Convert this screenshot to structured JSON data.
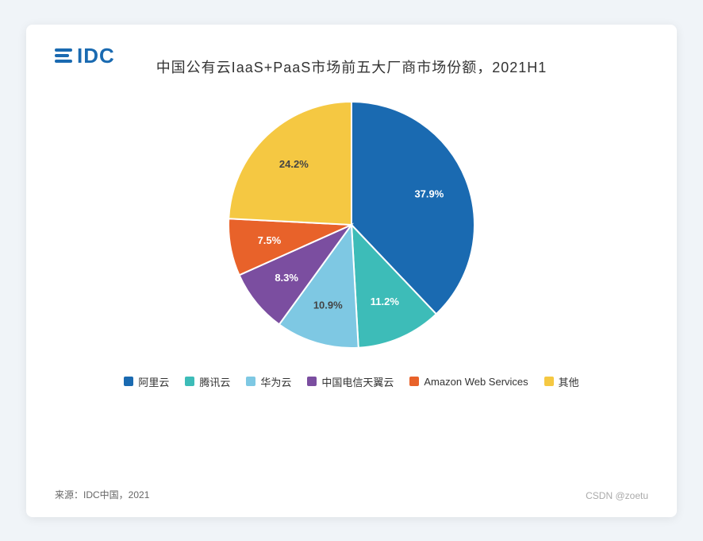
{
  "logo": {
    "text": "IDC"
  },
  "title": "中国公有云IaaS+PaaS市场前五大厂商市场份额，2021H1",
  "chart": {
    "segments": [
      {
        "name": "阿里云",
        "value": 37.9,
        "color": "#1a6ab1",
        "labelColor": "white"
      },
      {
        "name": "腾讯云",
        "value": 11.2,
        "color": "#3dbcb8",
        "labelColor": "white"
      },
      {
        "name": "华为云",
        "value": 10.9,
        "color": "#7ec8e3",
        "labelColor": "dark"
      },
      {
        "name": "中国电信天翼云",
        "value": 8.3,
        "color": "#7b4ea0",
        "labelColor": "white"
      },
      {
        "name": "Amazon Web Services",
        "value": 7.5,
        "color": "#e8622a",
        "labelColor": "white"
      },
      {
        "name": "其他",
        "value": 24.2,
        "color": "#f5c842",
        "labelColor": "dark"
      }
    ]
  },
  "legend": {
    "items": [
      {
        "label": "阿里云",
        "color": "#1a6ab1"
      },
      {
        "label": "腾讯云",
        "color": "#3dbcb8"
      },
      {
        "label": "华为云",
        "color": "#7ec8e3"
      },
      {
        "label": "中国电信天翼云",
        "color": "#7b4ea0"
      },
      {
        "label": "Amazon Web Services",
        "color": "#e8622a"
      },
      {
        "label": "其他",
        "color": "#f5c842"
      }
    ]
  },
  "footer": {
    "source": "来源：IDC中国，2021",
    "watermark": "CSDN @zoetu"
  }
}
